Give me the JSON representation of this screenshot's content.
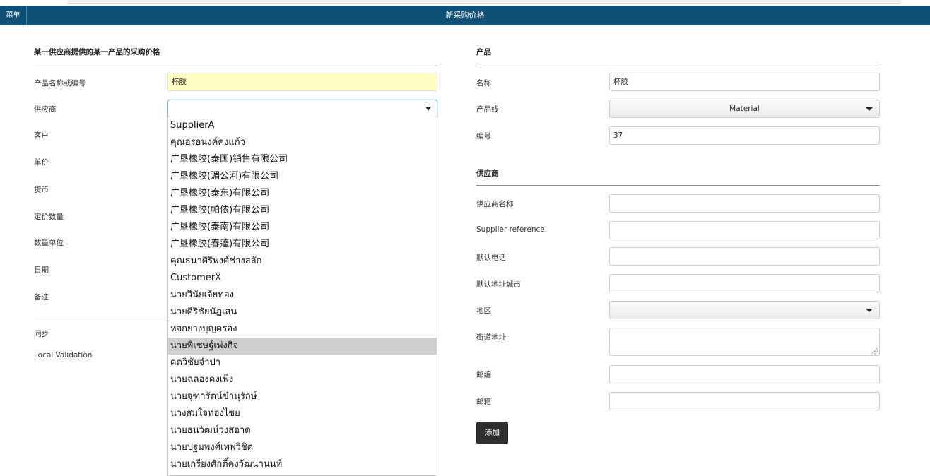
{
  "header": {
    "menu_label": "菜单",
    "title": "新采购价格"
  },
  "left": {
    "section_title": "某一供应商提供的某一产品的采购价格",
    "product_label": "产品名称或编号",
    "product_value": "杯胶",
    "supplier_label": "供应商",
    "supplier_value": "",
    "labels": {
      "customer": "客户",
      "unit_price": "单价",
      "currency": "货币",
      "price_qty": "定价数量",
      "qty_unit": "数量单位",
      "date": "日期",
      "notes": "备注",
      "sync": "同步",
      "local_validation": "Local Validation"
    },
    "supplier_options": [
      "SupplierA",
      "คุณอรอนงค์คงแก้ว",
      "广垦橡胶(泰国)销售有限公司",
      "广垦橡胶(湄公河)有限公司",
      "广垦橡胶(泰东)有限公司",
      "广垦橡胶(帕侬)有限公司",
      "广垦橡胶(泰南)有限公司",
      "广垦橡胶(春蓬)有限公司",
      "คุณธนาศิริพงศ์ช่างสลัก",
      "CustomerX",
      "นายวินัยเจ้ยทอง",
      "นายศิริชัยนัฏเสน",
      "หจกยางบุญครอง",
      "นายพิเชษฐ์เพ่งกิจ",
      "ดดวิชัยจำปา",
      "นายฉลองคงเพ็ง",
      "นายจุฑารัตน์ขำนุรักษ์",
      "นางสมใจทองไชย",
      "นายธนวัฒน์วงสอาด",
      "นายปฐมพงศ์เทพวิชิต",
      "นายเกรียงศักดิ์คงวัฒนานนท์"
    ],
    "highlighted_index": 13
  },
  "product": {
    "section_title": "产品",
    "name_label": "名称",
    "name_value": "杯胶",
    "line_label": "产品线",
    "line_value": "Material",
    "code_label": "编号",
    "code_value": "37"
  },
  "supplier": {
    "section_title": "供应商",
    "name_label": "供应商名称",
    "reference_label": "Supplier reference",
    "phone_label": "默认电话",
    "city_label": "默认地址城市",
    "region_label": "地区",
    "street_label": "街道地址",
    "zip_label": "邮编",
    "email_label": "邮箱",
    "add_label": "添加"
  }
}
